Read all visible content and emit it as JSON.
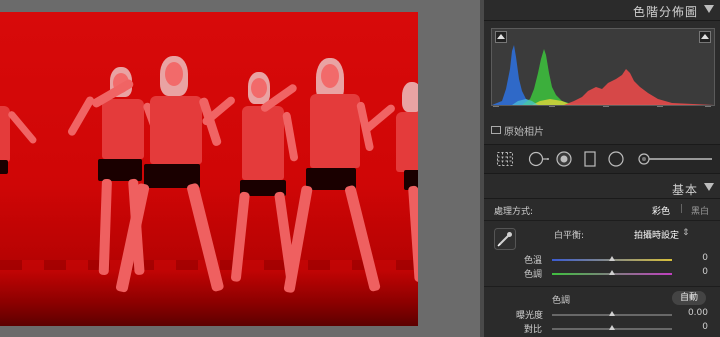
{
  "histogram_panel": {
    "title": "色階分佈圖",
    "original_photo_label": "原始相片"
  },
  "basic_panel": {
    "title": "基本",
    "treatment_label": "處理方式:",
    "treatment_color": "彩色",
    "treatment_separator": "|",
    "treatment_bw": "黑白",
    "white_balance_label": "白平衡:",
    "white_balance_value": "拍攝時設定",
    "white_balance_arrows": "⇕",
    "temp_label": "色溫",
    "temp_value": "0",
    "tint_label": "色調",
    "tint_value": "0",
    "tone_label": "色調",
    "auto_label": "自動",
    "exposure_label": "曝光度",
    "exposure_value": "0.00",
    "contrast_label": "對比",
    "contrast_value": "0"
  },
  "colors": {
    "photo_tint": "#d80a0a",
    "panel_bg": "#2b2b2b",
    "histogram_red": "#e84a4a",
    "histogram_green": "#3dbd3d",
    "histogram_blue": "#2f6fd8"
  },
  "icons": [
    "crop-overlay-icon",
    "spot-removal-icon",
    "red-eye-icon",
    "graduated-filter-icon",
    "radial-filter-icon",
    "adjustment-brush-icon",
    "white-balance-eyedropper-icon"
  ]
}
